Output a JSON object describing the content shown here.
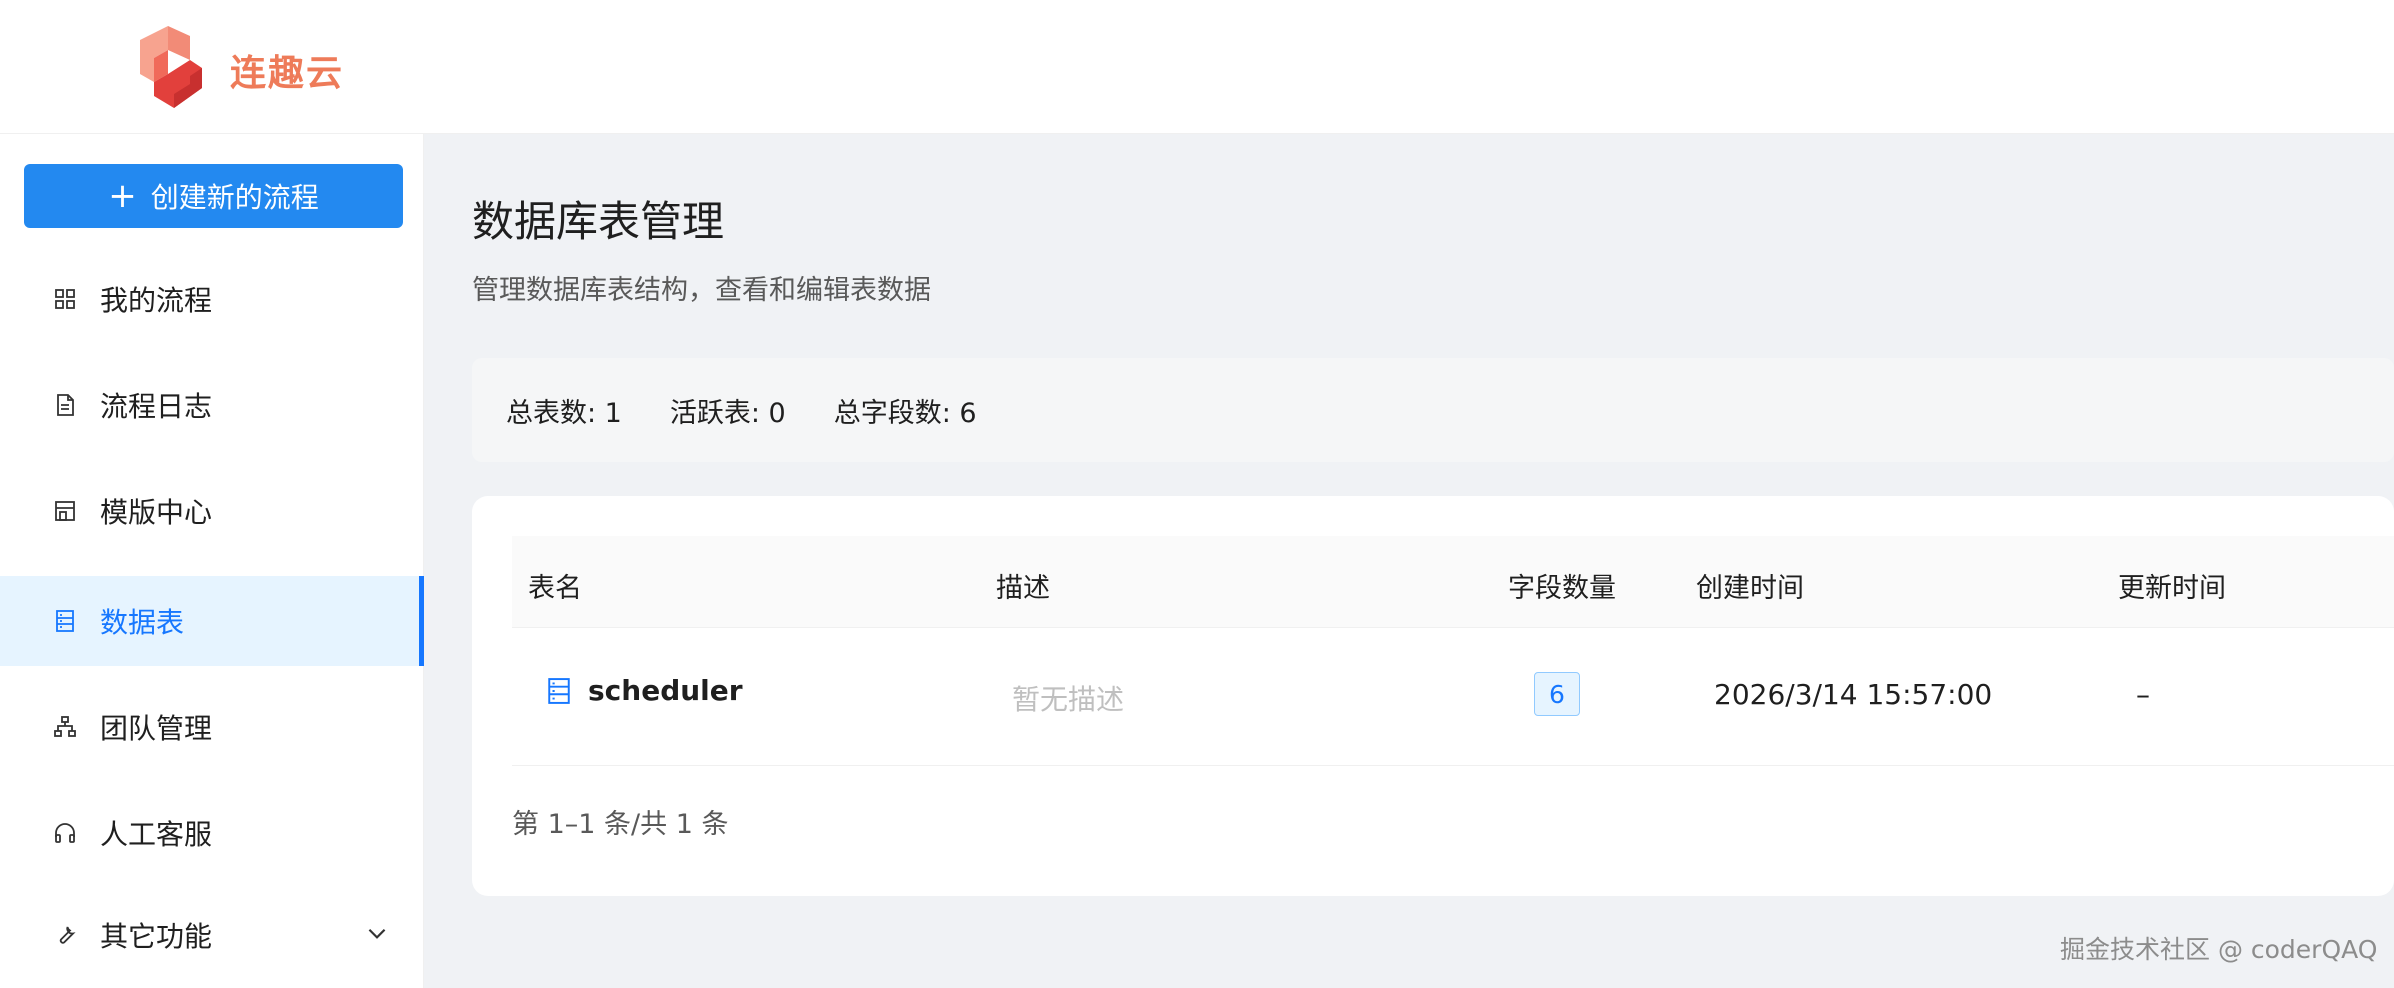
{
  "brand": {
    "name": "连趣云"
  },
  "sidebar": {
    "create_label": "创建新的流程",
    "items": [
      {
        "label": "我的流程",
        "icon": "grid-icon"
      },
      {
        "label": "流程日志",
        "icon": "document-icon"
      },
      {
        "label": "模版中心",
        "icon": "store-icon"
      },
      {
        "label": "数据表",
        "icon": "database-icon",
        "active": true
      },
      {
        "label": "团队管理",
        "icon": "team-tree-icon"
      },
      {
        "label": "人工客服",
        "icon": "headset-icon"
      },
      {
        "label": "其它功能",
        "icon": "wrench-icon",
        "expandable": true
      }
    ]
  },
  "main": {
    "title": "数据库表管理",
    "subtitle": "管理数据库表结构，查看和编辑表数据",
    "stats": {
      "total_tables": "总表数: 1",
      "active_tables": "活跃表: 0",
      "total_fields": "总字段数: 6"
    },
    "table": {
      "columns": [
        "表名",
        "描述",
        "字段数量",
        "创建时间",
        "更新时间"
      ],
      "rows": [
        {
          "name": "scheduler",
          "description": "暂无描述",
          "field_count": "6",
          "created_at": "2026/3/14 15:57:00",
          "updated_at": "–"
        }
      ]
    },
    "pagination": "第 1–1 条/共 1 条"
  },
  "watermark": "掘金技术社区 @ coderQAQ",
  "colors": {
    "primary": "#1677ff",
    "button": "#2389f0",
    "brand": "#ee7b59",
    "active_bg": "#e6f4ff"
  }
}
